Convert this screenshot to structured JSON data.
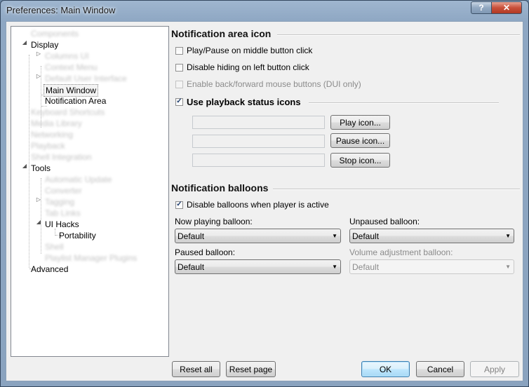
{
  "window": {
    "title": "Preferences: Main Window",
    "help_label": "?",
    "close_label": "✕"
  },
  "tree": {
    "display": "Display",
    "main_window": "Main Window",
    "notification_area": "Notification Area",
    "tools": "Tools",
    "ui_hacks": "UI Hacks",
    "portability": "Portability",
    "advanced": "Advanced",
    "blurred": [
      "Components",
      "Columns UI",
      "Context Menu",
      "Default User Interface",
      "Keyboard Shortcuts",
      "Media Library",
      "Networking",
      "Playback",
      "Shell Integration",
      "Automatic Update",
      "Converter",
      "Tagging",
      "Tab Links",
      "Shell",
      "Playlist Manager Plugins"
    ]
  },
  "notification_icon": {
    "title": "Notification area icon",
    "middle_click": {
      "label": "Play/Pause on middle button click",
      "checked": false
    },
    "disable_left": {
      "label": "Disable hiding on left button click",
      "checked": false
    },
    "back_forward": {
      "label": "Enable back/forward mouse buttons (DUI only)",
      "checked": false
    },
    "use_status_icons": {
      "label": "Use playback status icons",
      "checked": true
    },
    "play_icon_btn": "Play icon...",
    "pause_icon_btn": "Pause icon...",
    "stop_icon_btn": "Stop icon..."
  },
  "balloons": {
    "title": "Notification balloons",
    "disable_active": {
      "label": "Disable balloons when player is active",
      "checked": true
    },
    "now_playing": {
      "label": "Now playing balloon:",
      "value": "Default"
    },
    "unpaused": {
      "label": "Unpaused balloon:",
      "value": "Default"
    },
    "paused": {
      "label": "Paused balloon:",
      "value": "Default"
    },
    "volume": {
      "label": "Volume adjustment balloon:",
      "value": "Default"
    }
  },
  "footer": {
    "reset_all": "Reset all",
    "reset_page": "Reset page",
    "ok": "OK",
    "cancel": "Cancel",
    "apply": "Apply"
  },
  "checkmark": "✓",
  "colors": {
    "accent": "#3c7fb1",
    "title_bar": "#8ea7c3",
    "close_button": "#c9503a"
  }
}
